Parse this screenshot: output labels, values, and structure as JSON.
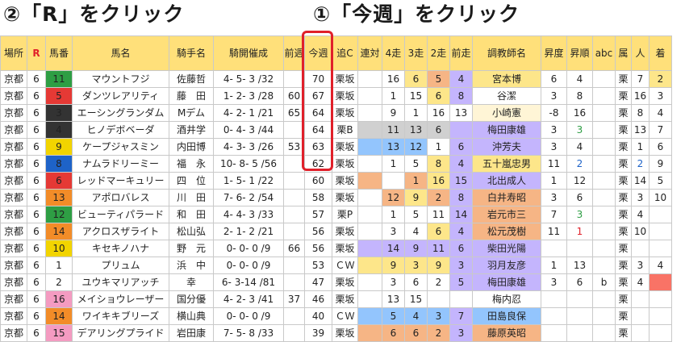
{
  "captions": {
    "left": "②「R」をクリック",
    "right": "①「今週」をクリック"
  },
  "columns": [
    {
      "key": "venue",
      "label": "場所"
    },
    {
      "key": "race",
      "label": "R"
    },
    {
      "key": "no",
      "label": "馬番"
    },
    {
      "key": "horse",
      "label": "馬名"
    },
    {
      "key": "jockey",
      "label": "騎手名"
    },
    {
      "key": "meet",
      "label": "騎開催成"
    },
    {
      "key": "prev",
      "label": "前週"
    },
    {
      "key": "now",
      "label": "今週"
    },
    {
      "key": "course",
      "label": "追C"
    },
    {
      "key": "ren",
      "label": "連対"
    },
    {
      "key": "w4",
      "label": "4走"
    },
    {
      "key": "w3",
      "label": "3走"
    },
    {
      "key": "w2",
      "label": "2走"
    },
    {
      "key": "w1",
      "label": "前走"
    },
    {
      "key": "trainer",
      "label": "調教師名"
    },
    {
      "key": "deg",
      "label": "昇度"
    },
    {
      "key": "ord",
      "label": "昇順"
    },
    {
      "key": "abc",
      "label": "abc"
    },
    {
      "key": "belong",
      "label": "属"
    },
    {
      "key": "ninki",
      "label": "人"
    },
    {
      "key": "last",
      "label": "着"
    }
  ],
  "colors": {
    "header": "#ffe07a",
    "selected_frame": "#e0202a",
    "orange": "#f6b585",
    "yellow": "#fde68a",
    "purple": "#c4b5fd",
    "blue": "#93c5fd",
    "gray": "#d0d0d0",
    "light": "#fff5d6",
    "red": "#f97366",
    "gate": {
      "1": "#ffffff",
      "2": "#333333",
      "3": "#e53935",
      "4": "#1e63c8",
      "5": "#f2d400",
      "6": "#2e9e44",
      "7": "#f28c28",
      "8": "#f49bc1"
    }
  },
  "rows": [
    {
      "venue": "京都",
      "race": "6",
      "no": "11",
      "gate": "6",
      "horse": "マウントフジ",
      "jockey": "佐藤哲",
      "meet": "4- 5- 3 /32",
      "prev": "",
      "now": "70",
      "course": "栗坂",
      "ren": "",
      "ren_c": "",
      "w4": "16",
      "w4_c": "",
      "w3": "6",
      "w3_c": "yellow",
      "w2": "5",
      "w2_c": "orange",
      "w1": "4",
      "w1_c": "purple",
      "trainer": "宮本博",
      "trainer_c": "yellow",
      "deg": "6",
      "ord": "4",
      "ord_c": "",
      "abc": "",
      "belong": "栗",
      "ninki": "7",
      "ninki_c": "",
      "last": "2",
      "last_c": "yellow"
    },
    {
      "venue": "京都",
      "race": "6",
      "no": "5",
      "gate": "3",
      "horse": "ダンツレアリティ",
      "jockey": "藤　田",
      "meet": "1- 2- 3 /28",
      "prev": "60",
      "now": "67",
      "course": "栗坂",
      "ren": "",
      "ren_c": "",
      "w4": "1",
      "w4_c": "",
      "w3": "15",
      "w3_c": "",
      "w2": "6",
      "w2_c": "yellow",
      "w1": "8",
      "w1_c": "purple",
      "trainer": "谷潔",
      "trainer_c": "",
      "deg": "3",
      "ord": "8",
      "ord_c": "",
      "abc": "",
      "belong": "栗",
      "ninki": "16",
      "ninki_c": "",
      "last": "3",
      "last_c": ""
    },
    {
      "venue": "京都",
      "race": "6",
      "no": "3",
      "gate": "2",
      "horse": "エーシングランダム",
      "jockey": "Mデム",
      "meet": "4- 2- 1 /21",
      "prev": "65",
      "now": "64",
      "course": "栗坂",
      "ren": "",
      "ren_c": "",
      "w4": "9",
      "w4_c": "",
      "w3": "1",
      "w3_c": "",
      "w2": "16",
      "w2_c": "",
      "w1": "13",
      "w1_c": "",
      "trainer": "小崎憲",
      "trainer_c": "light",
      "deg": "-8",
      "ord": "16",
      "ord_c": "",
      "abc": "",
      "belong": "栗",
      "ninki": "8",
      "ninki_c": "",
      "last": "4",
      "last_c": ""
    },
    {
      "venue": "京都",
      "race": "6",
      "no": "4",
      "gate": "2",
      "horse": "ヒノデボベーダ",
      "jockey": "酒井学",
      "meet": "0- 4- 3 /44",
      "prev": "",
      "now": "64",
      "course": "栗B",
      "ren": "",
      "ren_c": "gray",
      "w4": "11",
      "w4_c": "gray",
      "w3": "13",
      "w3_c": "gray",
      "w2": "6",
      "w2_c": "gray",
      "w1": "",
      "w1_c": "purple",
      "trainer": "梅田康雄",
      "trainer_c": "purple",
      "deg": "3",
      "ord": "3",
      "ord_c": "",
      "abc": "",
      "belong": "栗",
      "ninki": "13",
      "ninki_c": "",
      "last": "7",
      "last_c": ""
    },
    {
      "venue": "京都",
      "race": "6",
      "no": "9",
      "gate": "5",
      "horse": "ケープジャスミン",
      "jockey": "内田博",
      "meet": "4- 3- 3 /26",
      "prev": "53",
      "now": "63",
      "course": "栗坂",
      "ren": "",
      "ren_c": "blue",
      "w4": "13",
      "w4_c": "blue",
      "w3": "12",
      "w3_c": "blue",
      "w2": "1",
      "w2_c": "",
      "w1": "6",
      "w1_c": "purple",
      "trainer": "沖芳夫",
      "trainer_c": "purple",
      "deg": "3",
      "ord": "4",
      "ord_c": "",
      "abc": "",
      "belong": "栗",
      "ninki": "1",
      "ninki_c": "",
      "last": "6",
      "last_c": ""
    },
    {
      "venue": "京都",
      "race": "6",
      "no": "8",
      "gate": "4",
      "horse": "ナムラドリーミー",
      "jockey": "福　永",
      "meet": "10- 8- 5 /56",
      "prev": "",
      "now": "62",
      "course": "栗坂",
      "ren": "",
      "ren_c": "",
      "w4": "1",
      "w4_c": "",
      "w3": "5",
      "w3_c": "",
      "w2": "8",
      "w2_c": "yellow",
      "w1": "4",
      "w1_c": "purple",
      "trainer": "五十嵐忠男",
      "trainer_c": "yellow",
      "deg": "11",
      "ord": "2",
      "ord_c": "",
      "abc": "",
      "belong": "栗",
      "ninki": "2",
      "ninki_c": "",
      "last": "9",
      "last_c": ""
    },
    {
      "venue": "京都",
      "race": "6",
      "no": "6",
      "gate": "3",
      "horse": "レッドマーキュリー",
      "jockey": "四　位",
      "meet": "1- 5- 1 /22",
      "prev": "",
      "now": "60",
      "course": "栗坂",
      "ren": "",
      "ren_c": "orange",
      "w4": "",
      "w4_c": "",
      "w3": "1",
      "w3_c": "orange",
      "w2": "16",
      "w2_c": "yellow",
      "w1": "15",
      "w1_c": "purple",
      "trainer": "北出成人",
      "trainer_c": "purple",
      "deg": "1",
      "ord": "12",
      "ord_c": "",
      "abc": "",
      "belong": "栗",
      "ninki": "14",
      "ninki_c": "",
      "last": "5",
      "last_c": ""
    },
    {
      "venue": "京都",
      "race": "6",
      "no": "13",
      "gate": "7",
      "horse": "アポロバレス",
      "jockey": "川　田",
      "meet": "7- 6- 2 /54",
      "prev": "",
      "now": "58",
      "course": "栗坂",
      "ren": "",
      "ren_c": "",
      "w4": "12",
      "w4_c": "orange",
      "w3": "9",
      "w3_c": "yellow",
      "w2": "2",
      "w2_c": "orange",
      "w1": "8",
      "w1_c": "purple",
      "trainer": "白井寿昭",
      "trainer_c": "orange",
      "deg": "3",
      "ord": "6",
      "ord_c": "",
      "abc": "",
      "belong": "栗",
      "ninki": "3",
      "ninki_c": "",
      "last": "10",
      "last_c": ""
    },
    {
      "venue": "京都",
      "race": "6",
      "no": "12",
      "gate": "6",
      "horse": "ビューティパラード",
      "jockey": "和　田",
      "meet": "4- 4- 3 /33",
      "prev": "",
      "now": "57",
      "course": "栗P",
      "ren": "",
      "ren_c": "",
      "w4": "1",
      "w4_c": "",
      "w3": "5",
      "w3_c": "",
      "w2": "11",
      "w2_c": "",
      "w1": "14",
      "w1_c": "purple",
      "trainer": "岩元市三",
      "trainer_c": "orange",
      "deg": "7",
      "ord": "3",
      "ord_c": "",
      "abc": "",
      "belong": "栗",
      "ninki": "4",
      "ninki_c": "",
      "last": "",
      "last_c": ""
    },
    {
      "venue": "京都",
      "race": "6",
      "no": "14",
      "gate": "7",
      "horse": "アクロスザライト",
      "jockey": "松山弘",
      "meet": "2- 1- 2 /21",
      "prev": "",
      "now": "56",
      "course": "栗坂",
      "ren": "",
      "ren_c": "",
      "w4": "3",
      "w4_c": "",
      "w3": "4",
      "w3_c": "",
      "w2": "6",
      "w2_c": "yellow",
      "w1": "4",
      "w1_c": "purple",
      "trainer": "松元茂樹",
      "trainer_c": "orange",
      "deg": "11",
      "ord": "1",
      "ord_c": "",
      "abc": "",
      "belong": "栗",
      "ninki": "10",
      "ninki_c": "",
      "last": "",
      "last_c": ""
    },
    {
      "venue": "京都",
      "race": "6",
      "no": "10",
      "gate": "5",
      "horse": "キセキノハナ",
      "jockey": "野　元",
      "meet": "0- 0- 0 /9",
      "prev": "66",
      "now": "56",
      "course": "栗坂",
      "ren": "",
      "ren_c": "purple",
      "w4": "14",
      "w4_c": "purple",
      "w3": "9",
      "w3_c": "purple",
      "w2": "11",
      "w2_c": "purple",
      "w1": "6",
      "w1_c": "purple",
      "trainer": "柴田光陽",
      "trainer_c": "purple",
      "deg": "",
      "ord": "",
      "ord_c": "",
      "abc": "",
      "belong": "栗",
      "ninki": "",
      "ninki_c": "",
      "last": "",
      "last_c": ""
    },
    {
      "venue": "京都",
      "race": "6",
      "no": "1",
      "gate": "1",
      "horse": "プリュム",
      "jockey": "浜　中",
      "meet": "0- 0- 0 /9",
      "prev": "",
      "now": "53",
      "course": "ＣＷ",
      "ren": "",
      "ren_c": "yellow",
      "w4": "9",
      "w4_c": "yellow",
      "w3": "3",
      "w3_c": "yellow",
      "w2": "9",
      "w2_c": "yellow",
      "w1": "3",
      "w1_c": "purple",
      "trainer": "羽月友彦",
      "trainer_c": "purple",
      "deg": "1",
      "ord": "13",
      "ord_c": "",
      "abc": "",
      "belong": "栗",
      "ninki": "3",
      "ninki_c": "",
      "last": "4",
      "last_c": ""
    },
    {
      "venue": "京都",
      "race": "6",
      "no": "2",
      "gate": "1",
      "horse": "ユウキマリアッチ",
      "jockey": "幸",
      "meet": "6- 3-14 /81",
      "prev": "",
      "now": "47",
      "course": "栗坂",
      "ren": "",
      "ren_c": "",
      "w4": "3",
      "w4_c": "",
      "w3": "6",
      "w3_c": "",
      "w2": "2",
      "w2_c": "",
      "w1": "5",
      "w1_c": "purple",
      "trainer": "梅田康雄",
      "trainer_c": "purple",
      "deg": "3",
      "ord": "6",
      "ord_c": "",
      "abc": "b",
      "belong": "栗",
      "ninki": "4",
      "ninki_c": "",
      "last": "",
      "last_c": "red"
    },
    {
      "venue": "京都",
      "race": "6",
      "no": "16",
      "gate": "8",
      "horse": "メイショウレーザー",
      "jockey": "国分優",
      "meet": "4- 2- 3 /41",
      "prev": "37",
      "now": "46",
      "course": "栗坂",
      "ren": "",
      "ren_c": "",
      "w4": "13",
      "w4_c": "",
      "w3": "15",
      "w3_c": "",
      "w2": "",
      "w2_c": "",
      "w1": "",
      "w1_c": "",
      "trainer": "梅内忍",
      "trainer_c": "",
      "deg": "",
      "ord": "",
      "ord_c": "",
      "abc": "",
      "belong": "栗",
      "ninki": "",
      "ninki_c": "",
      "last": "",
      "last_c": ""
    },
    {
      "venue": "京都",
      "race": "6",
      "no": "14",
      "gate": "7",
      "horse": "ワイキキブリーズ",
      "jockey": "横山典",
      "meet": "0- 0- 0 /9",
      "prev": "",
      "now": "40",
      "course": "ＣＷ",
      "ren": "",
      "ren_c": "blue",
      "w4": "5",
      "w4_c": "blue",
      "w3": "4",
      "w3_c": "blue",
      "w2": "3",
      "w2_c": "blue",
      "w1": "7",
      "w1_c": "purple",
      "trainer": "田島良保",
      "trainer_c": "blue",
      "deg": "",
      "ord": "",
      "ord_c": "",
      "abc": "",
      "belong": "栗",
      "ninki": "",
      "ninki_c": "",
      "last": "",
      "last_c": ""
    },
    {
      "venue": "京都",
      "race": "6",
      "no": "15",
      "gate": "8",
      "horse": "デアリングプライド",
      "jockey": "岩田康",
      "meet": "7- 5- 8 /33",
      "prev": "",
      "now": "39",
      "course": "栗坂",
      "ren": "",
      "ren_c": "orange",
      "w4": "6",
      "w4_c": "orange",
      "w3": "6",
      "w3_c": "orange",
      "w2": "2",
      "w2_c": "orange",
      "w1": "3",
      "w1_c": "purple",
      "trainer": "藤原英昭",
      "trainer_c": "orange",
      "deg": "",
      "ord": "",
      "ord_c": "",
      "abc": "",
      "belong": "栗",
      "ninki": "",
      "ninki_c": "",
      "last": "",
      "last_c": ""
    }
  ]
}
